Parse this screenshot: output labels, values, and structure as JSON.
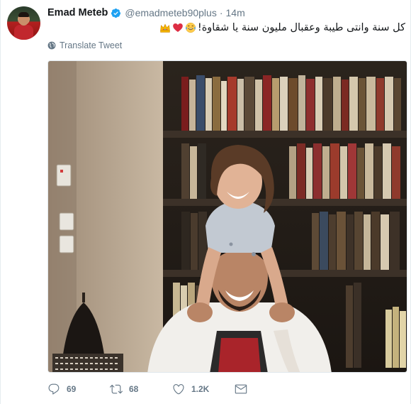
{
  "tweet": {
    "author_name": "Emad Meteb",
    "handle": "@emadmeteb90plus",
    "separator": "·",
    "time": "14m",
    "text": "كل سنة وانتى طيبة وعقبال مليون سنة يا شقاوة!",
    "emojis": [
      "face-with-tears-of-joy",
      "red-heart",
      "crown"
    ],
    "translate_label": "Translate Tweet"
  },
  "actions": {
    "reply_count": "69",
    "retweet_count": "68",
    "like_count": "1.2K"
  },
  "colors": {
    "text": "#14171a",
    "secondary": "#657786",
    "verified": "#1da1f2",
    "heart": "#e0245e"
  }
}
